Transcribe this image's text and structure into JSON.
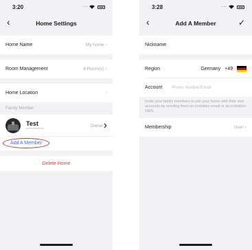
{
  "left": {
    "status_time": "3:20",
    "status_dots": "....",
    "title": "Home Settings",
    "rows": {
      "home_name": {
        "label": "Home Name",
        "value": "My home"
      },
      "room_management": {
        "label": "Room Management",
        "value": "6 Room(s)"
      },
      "home_location": {
        "label": "Home Location"
      }
    },
    "family_section_label": "Family Member",
    "member": {
      "name": "Test",
      "sub": "***********",
      "role": "Owner"
    },
    "add_member_label": "Add A Member",
    "delete_label": "Delete Home"
  },
  "right": {
    "status_time": "3:28",
    "status_dots": "....",
    "title": "Add A Member",
    "nickname_label": "Nickname",
    "region": {
      "label": "Region",
      "country": "Germany",
      "code": "+49"
    },
    "account": {
      "label": "Account",
      "placeholder": "Phone Number/Email"
    },
    "invite_note": "Invite your family members to join your home with their own accounts by sending them an invitation email or an invitation SMS.",
    "membership": {
      "label": "Membership",
      "value": "User"
    }
  },
  "icons": {
    "back": "chevron-left-icon",
    "confirm": "checkmark-icon",
    "chevron": "chevron-right-icon",
    "flag": "germany-flag-icon"
  },
  "colors": {
    "add_link": "#3a6ee0",
    "highlight_circle": "#d62a2a",
    "delete": "#e23c2f",
    "flag": [
      "#000000",
      "#dd0000",
      "#ffce00"
    ]
  }
}
